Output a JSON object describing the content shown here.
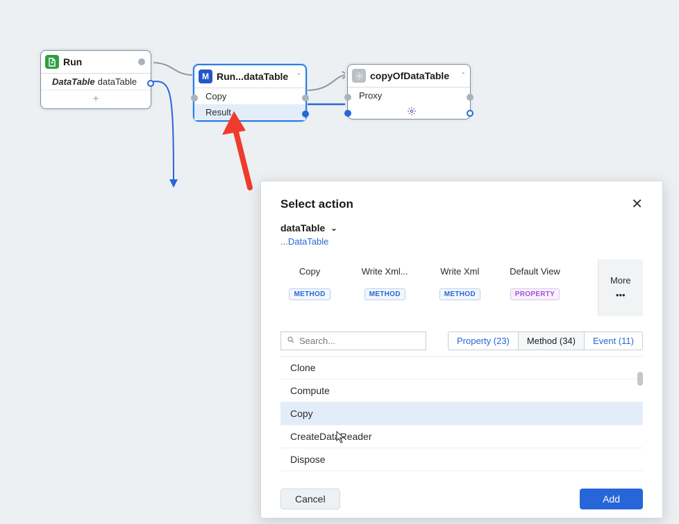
{
  "nodes": {
    "run": {
      "title": "Run",
      "param_type": "DataTable",
      "param_name": "dataTable"
    },
    "middle": {
      "icon_letter": "M",
      "title": "Run...dataTable",
      "row_copy": "Copy",
      "row_result": "Result"
    },
    "right": {
      "title": "copyOfDataTable",
      "row_proxy": "Proxy"
    }
  },
  "popup": {
    "title": "Select action",
    "context_object": "dataTable",
    "context_type": "...DataTable",
    "suggestions": [
      {
        "label": "Copy",
        "tag": "METHOD",
        "tag_class": "method"
      },
      {
        "label": "Write Xml...",
        "tag": "METHOD",
        "tag_class": "method"
      },
      {
        "label": "Write Xml",
        "tag": "METHOD",
        "tag_class": "method"
      },
      {
        "label": "Default View",
        "tag": "PROPERTY",
        "tag_class": "property"
      }
    ],
    "more_label": "More",
    "search_placeholder": "Search...",
    "filters": {
      "property": "Property (23)",
      "method": "Method (34)",
      "event": "Event (11)"
    },
    "methods": [
      "Clone",
      "Compute",
      "Copy",
      "CreateDataReader",
      "Dispose"
    ],
    "selected_method_index": 2,
    "cancel": "Cancel",
    "add": "Add"
  }
}
